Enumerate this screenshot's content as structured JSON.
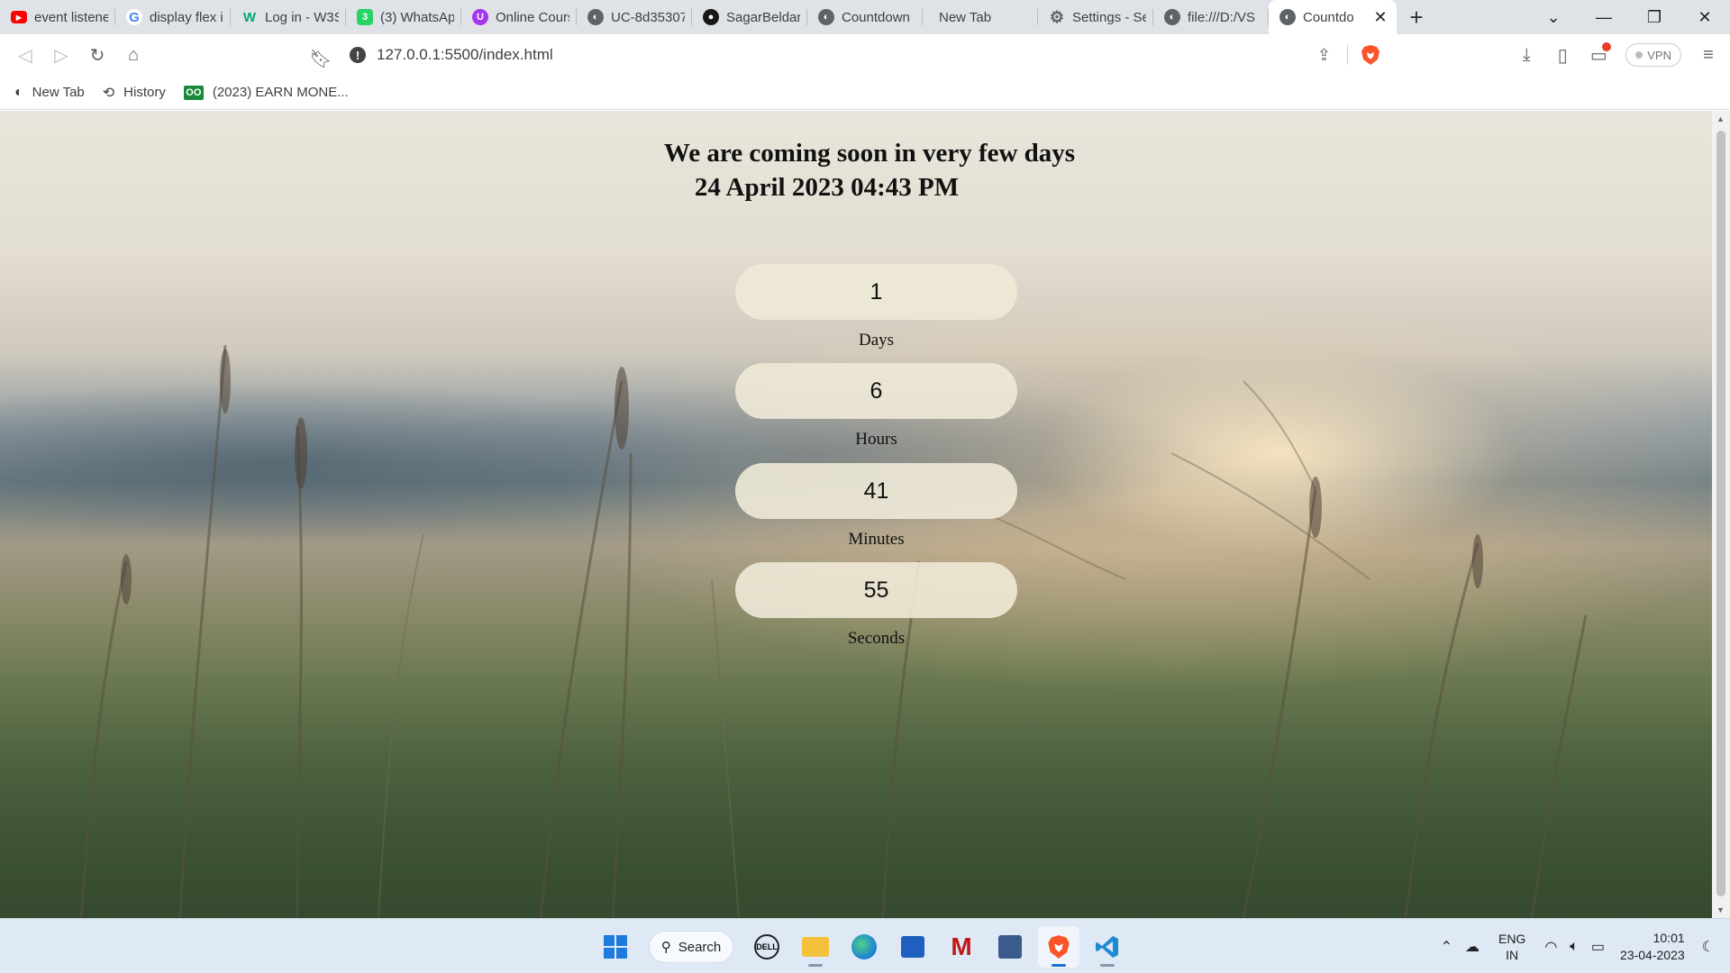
{
  "browser": {
    "tabs": [
      {
        "title": "event listener",
        "favicon": "youtube-icon",
        "color": "#ff0000"
      },
      {
        "title": "display flex in",
        "favicon": "google-icon",
        "color": "#4285f4"
      },
      {
        "title": "Log in - W3S",
        "favicon": "w3schools-icon",
        "color": "#04aa6d"
      },
      {
        "title": "(3) WhatsApp",
        "favicon": "whatsapp-icon",
        "color": "#25d366"
      },
      {
        "title": "Online Cours",
        "favicon": "udemy-icon",
        "color": "#a435f0"
      },
      {
        "title": "UC-8d35307",
        "favicon": "globe-icon",
        "color": "#5f6368"
      },
      {
        "title": "SagarBeldar/",
        "favicon": "github-icon",
        "color": "#181717"
      },
      {
        "title": "Countdown",
        "favicon": "globe-icon",
        "color": "#5f6368"
      },
      {
        "title": "New Tab",
        "favicon": "",
        "color": ""
      },
      {
        "title": "Settings - Se",
        "favicon": "gear-icon",
        "color": "#5f6368"
      },
      {
        "title": "file:///D:/VS",
        "favicon": "globe-icon",
        "color": "#5f6368"
      },
      {
        "title": "Countdo",
        "favicon": "globe-icon",
        "color": "#5f6368",
        "active": true
      }
    ],
    "address": "127.0.0.1:5500/index.html",
    "vpn_label": "VPN",
    "bookmarks": [
      {
        "label": "New Tab",
        "icon": "globe-icon"
      },
      {
        "label": "History",
        "icon": "history-icon"
      },
      {
        "label": "(2023) EARN MONE...",
        "icon": "oo-icon"
      }
    ]
  },
  "page": {
    "heading_line1": "We are coming soon in very few days",
    "heading_line2": "24 April 2023 04:43 PM",
    "counters": [
      {
        "value": "1",
        "label": "Days"
      },
      {
        "value": "6",
        "label": "Hours"
      },
      {
        "value": "41",
        "label": "Minutes"
      },
      {
        "value": "55",
        "label": "Seconds"
      }
    ]
  },
  "taskbar": {
    "search_label": "Search",
    "lang_line1": "ENG",
    "lang_line2": "IN",
    "time": "10:01",
    "date": "23-04-2023"
  }
}
